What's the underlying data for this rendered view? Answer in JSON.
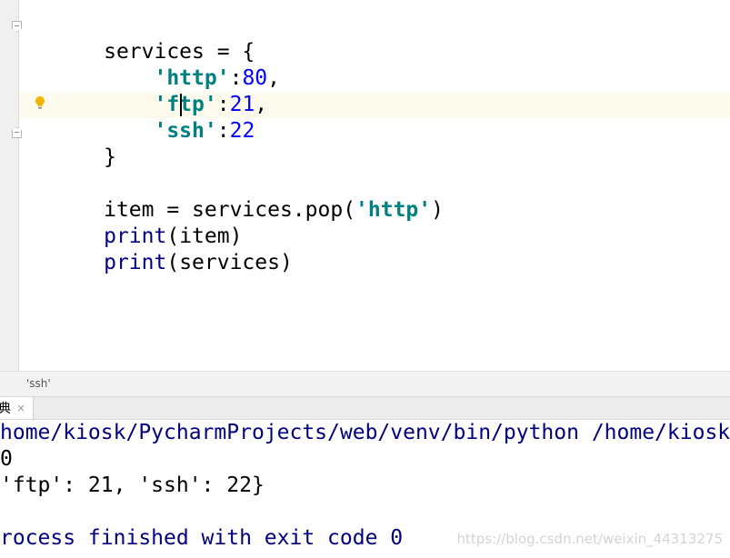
{
  "editor": {
    "lines": [
      {
        "id": 0,
        "parts": [
          "services = {"
        ]
      },
      {
        "id": 1,
        "parts": [
          "'http'",
          ":",
          "80",
          ","
        ]
      },
      {
        "id": 2,
        "parts": [
          "'ftp'",
          ":",
          "21",
          ","
        ]
      },
      {
        "id": 3,
        "parts": [
          "'ssh'",
          ":",
          "22"
        ]
      },
      {
        "id": 4,
        "parts": [
          "}"
        ]
      },
      {
        "id": 5,
        "parts": [
          "item = services.pop(",
          "'http'",
          ")"
        ]
      },
      {
        "id": 6,
        "parts": [
          "print",
          "(item)"
        ]
      },
      {
        "id": 7,
        "parts": [
          "print",
          "(services)"
        ]
      }
    ],
    "indent": "    "
  },
  "breadcrumb": {
    "text": "'ssh'"
  },
  "run_tab": {
    "label": "典",
    "close_glyph": "×"
  },
  "console": {
    "command": "home/kiosk/PycharmProjects/web/venv/bin/python /home/kiosk",
    "output_1": "0",
    "output_2": "'ftp': 21, 'ssh': 22}",
    "exit_message": "rocess finished with exit code 0"
  },
  "watermark": "https://blog.csdn.net/weixin_44313275",
  "icons": {
    "fold_open": "fold-open-icon",
    "fold_close": "fold-close-icon",
    "intention": "lightbulb-icon"
  },
  "colors": {
    "string": "#008080",
    "number": "#0000ff",
    "builtin": "#000080",
    "current_line": "#fcfaed"
  }
}
